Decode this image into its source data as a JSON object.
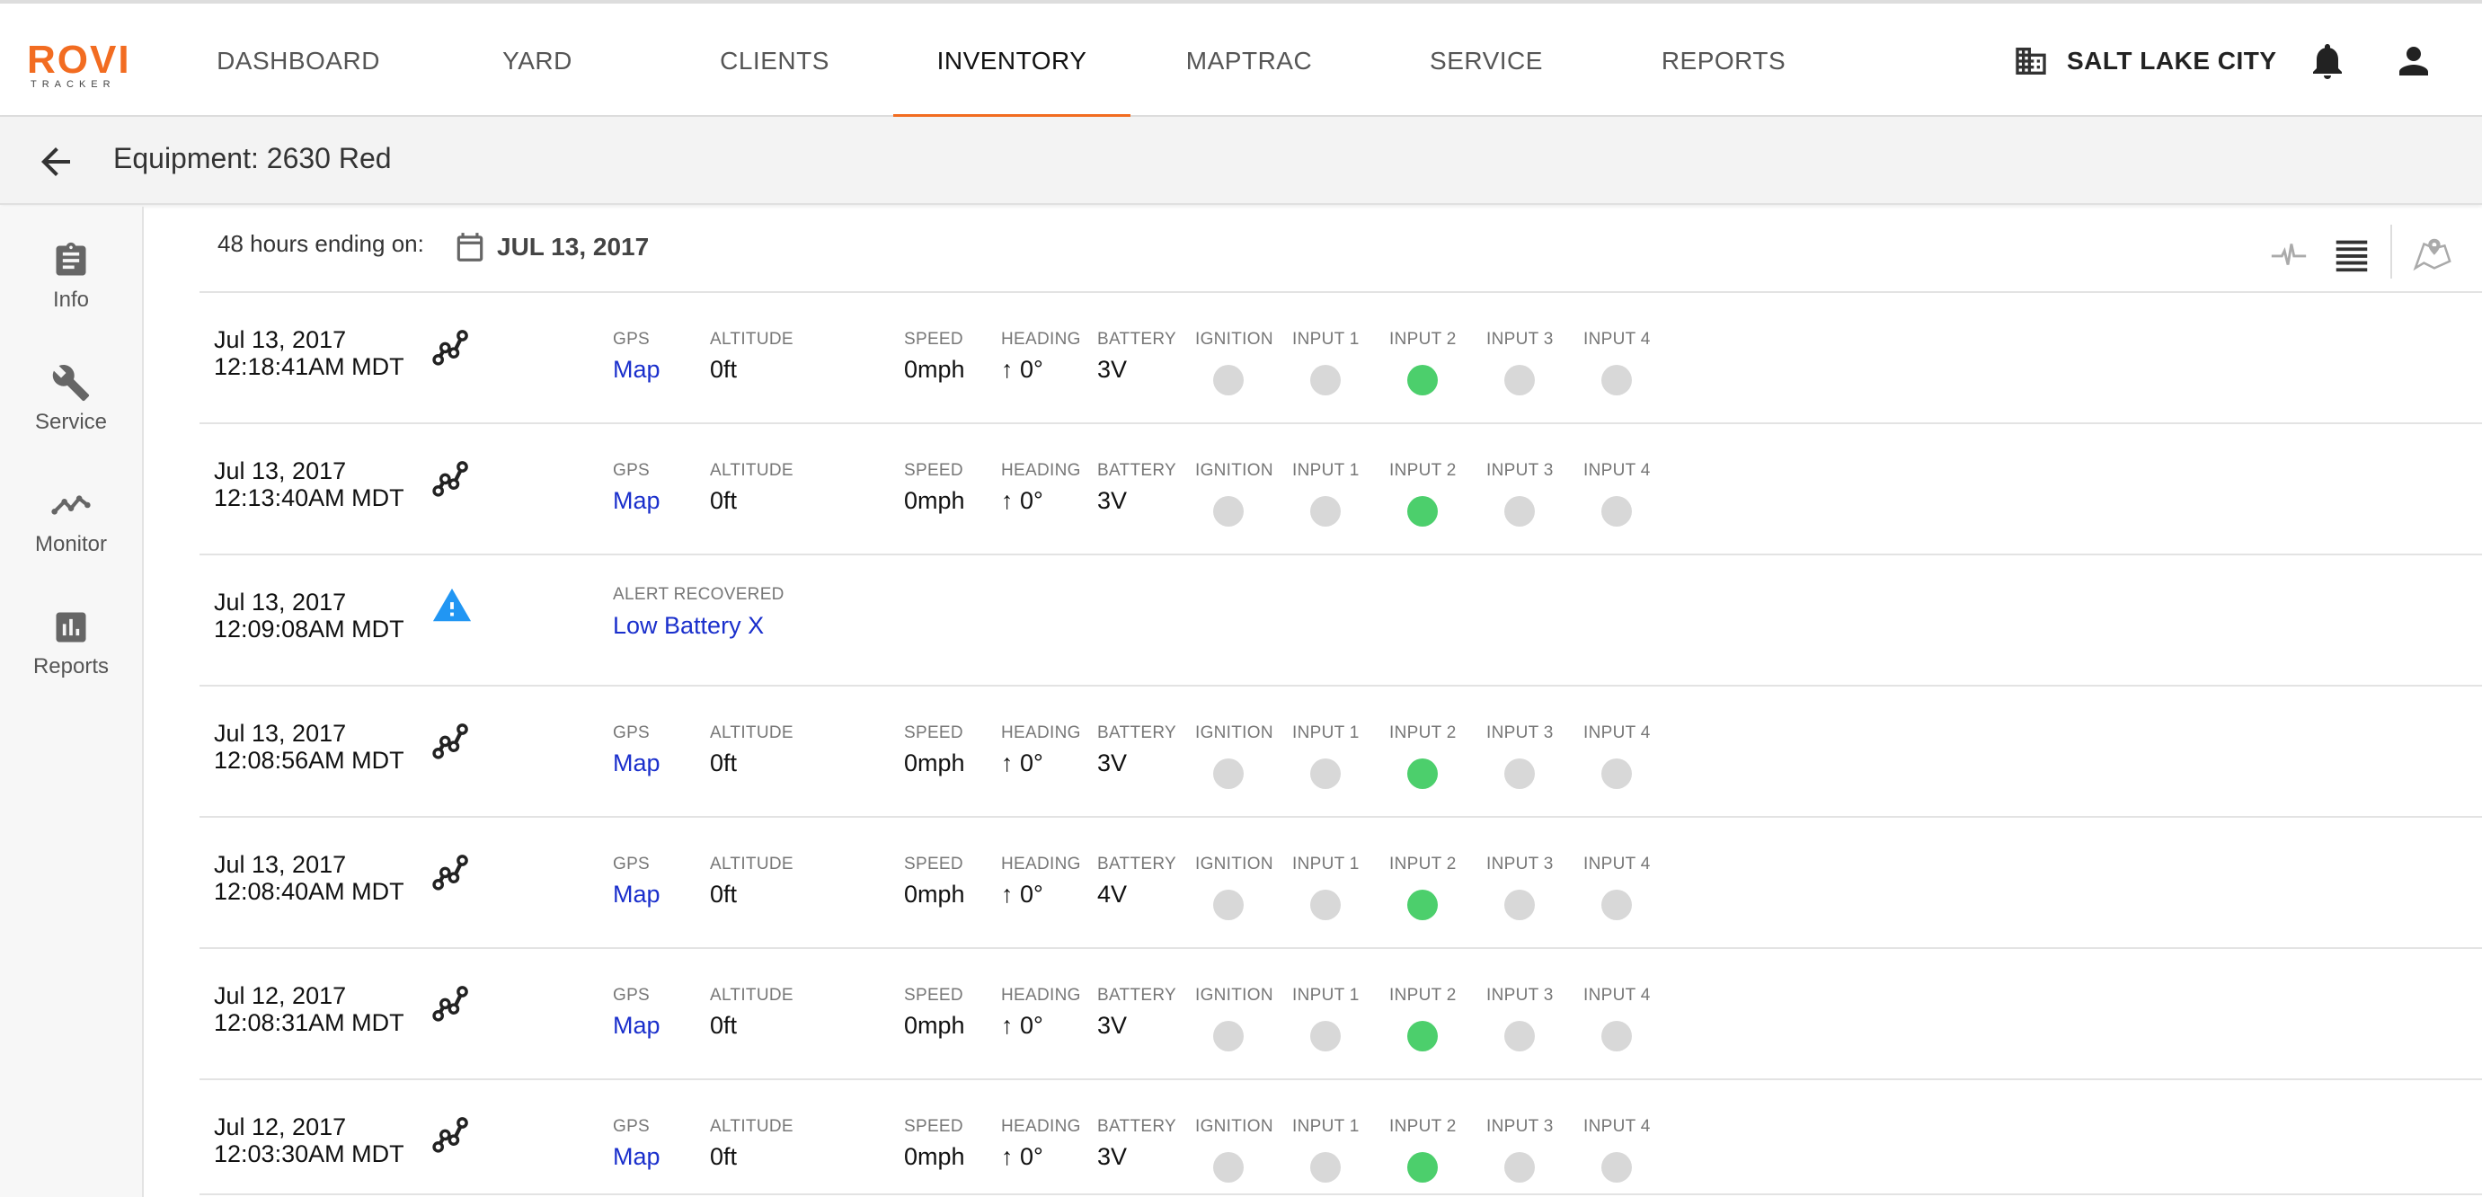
{
  "app": {
    "logo_text": "ROVI",
    "logo_sub": "TRACKER"
  },
  "nav": {
    "tabs": [
      {
        "label": "DASHBOARD",
        "active": false
      },
      {
        "label": "YARD",
        "active": false
      },
      {
        "label": "CLIENTS",
        "active": false
      },
      {
        "label": "INVENTORY",
        "active": true
      },
      {
        "label": "MAPTRAC",
        "active": false
      },
      {
        "label": "SERVICE",
        "active": false
      },
      {
        "label": "REPORTS",
        "active": false
      }
    ],
    "location": "SALT LAKE CITY",
    "location_icon": "building-icon",
    "notifications_icon": "bell-icon",
    "account_icon": "person-icon",
    "accent_color": "#f26c21"
  },
  "page": {
    "title": "Equipment: 2630 Red",
    "back_icon": "arrow-left-icon"
  },
  "sidebar": {
    "items": [
      {
        "label": "Info",
        "icon": "clipboard-icon"
      },
      {
        "label": "Service",
        "icon": "wrench-icon"
      },
      {
        "label": "Monitor",
        "icon": "trend-line-icon"
      },
      {
        "label": "Reports",
        "icon": "bar-chart-icon"
      }
    ]
  },
  "filter": {
    "range_label": "48 hours ending on:",
    "date": "JUL 13, 2017",
    "tools": [
      "pulse-icon",
      "list-icon",
      "map-pin-icon"
    ]
  },
  "columns": {
    "gps": "GPS",
    "altitude": "ALTITUDE",
    "speed": "SPEED",
    "heading": "HEADING",
    "battery": "BATTERY",
    "ignition": "IGNITION",
    "input1": "INPUT 1",
    "input2": "INPUT 2",
    "input3": "INPUT 3",
    "input4": "INPUT 4"
  },
  "colors": {
    "input_on": "#4ccf6c",
    "input_off": "#d8d8d8",
    "link": "#1a2fcc",
    "alert": "#2196f3"
  },
  "events": [
    {
      "type": "gps",
      "date": "Jul 13, 2017",
      "time": "12:18:41AM MDT",
      "gps": "Map",
      "altitude": "0ft",
      "speed": "0mph",
      "heading": "↑ 0°",
      "battery": "3V",
      "inputs": [
        false,
        false,
        true,
        false,
        false
      ]
    },
    {
      "type": "gps",
      "date": "Jul 13, 2017",
      "time": "12:13:40AM MDT",
      "gps": "Map",
      "altitude": "0ft",
      "speed": "0mph",
      "heading": "↑ 0°",
      "battery": "3V",
      "inputs": [
        false,
        false,
        true,
        false,
        false
      ]
    },
    {
      "type": "alert",
      "date": "Jul 13, 2017",
      "time": "12:09:08AM MDT",
      "alert_label": "ALERT RECOVERED",
      "alert_text": "Low Battery X"
    },
    {
      "type": "gps",
      "date": "Jul 13, 2017",
      "time": "12:08:56AM MDT",
      "gps": "Map",
      "altitude": "0ft",
      "speed": "0mph",
      "heading": "↑ 0°",
      "battery": "3V",
      "inputs": [
        false,
        false,
        true,
        false,
        false
      ]
    },
    {
      "type": "gps",
      "date": "Jul 13, 2017",
      "time": "12:08:40AM MDT",
      "gps": "Map",
      "altitude": "0ft",
      "speed": "0mph",
      "heading": "↑ 0°",
      "battery": "4V",
      "inputs": [
        false,
        false,
        true,
        false,
        false
      ]
    },
    {
      "type": "gps",
      "date": "Jul 12, 2017",
      "time": "12:08:31AM MDT",
      "gps": "Map",
      "altitude": "0ft",
      "speed": "0mph",
      "heading": "↑ 0°",
      "battery": "3V",
      "inputs": [
        false,
        false,
        true,
        false,
        false
      ]
    },
    {
      "type": "gps",
      "date": "Jul 12, 2017",
      "time": "12:03:30AM MDT",
      "gps": "Map",
      "altitude": "0ft",
      "speed": "0mph",
      "heading": "↑ 0°",
      "battery": "3V",
      "inputs": [
        false,
        false,
        true,
        false,
        false
      ]
    }
  ]
}
